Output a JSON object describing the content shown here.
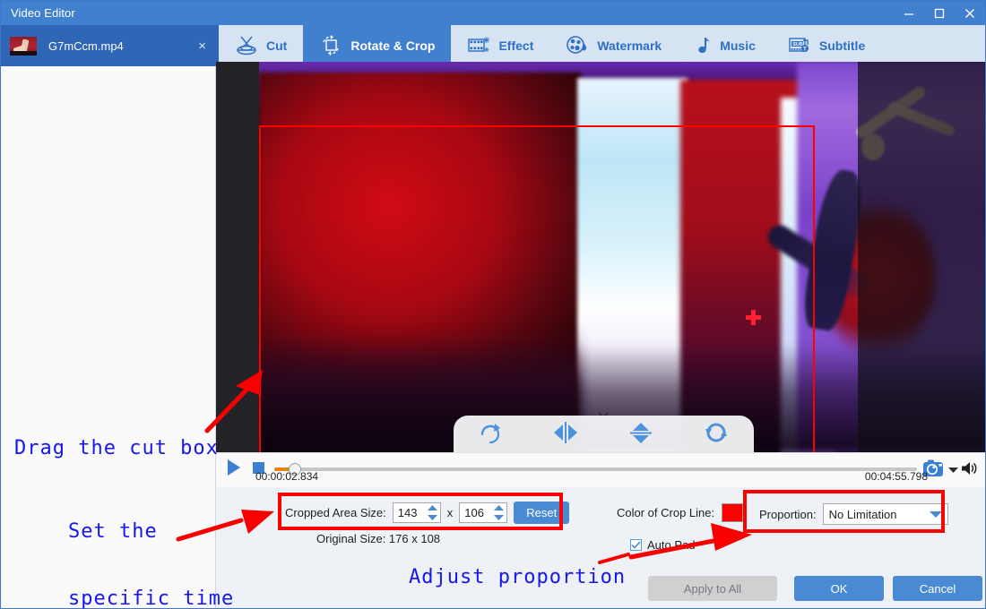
{
  "window": {
    "title": "Video Editor",
    "minimize_icon": "minimize-icon",
    "maximize_icon": "maximize-icon",
    "close_icon": "close-icon"
  },
  "file_tab": {
    "name": "G7mCcm.mp4",
    "close_label": "×"
  },
  "tabs": [
    {
      "label": "Cut",
      "icon": "scissors-icon",
      "active": false
    },
    {
      "label": "Rotate & Crop",
      "icon": "crop-rotate-icon",
      "active": true
    },
    {
      "label": "Effect",
      "icon": "film-sparkle-icon",
      "active": false
    },
    {
      "label": "Watermark",
      "icon": "watermark-drop-icon",
      "active": false
    },
    {
      "label": "Music",
      "icon": "music-note-icon",
      "active": false
    },
    {
      "label": "Subtitle",
      "icon": "subtitle-icon",
      "active": false
    }
  ],
  "stage": {
    "rotate_tools": [
      {
        "name": "rotate-clockwise-icon"
      },
      {
        "name": "flip-horizontal-icon"
      },
      {
        "name": "flip-vertical-icon"
      },
      {
        "name": "rotate-reset-icon"
      }
    ],
    "collapse_icon": "chevron-down-icon",
    "crop_line_color": "#ff0000",
    "crosshair_icon": "crosshair-icon"
  },
  "player": {
    "play_icon": "play-icon",
    "stop_icon": "stop-icon",
    "current_time": "00:00:02.834",
    "total_time": "00:04:55.798",
    "snapshot_icon": "camera-icon",
    "snapshot_dropdown_icon": "chevron-down-icon",
    "volume_icon": "volume-icon",
    "progress_percent": 1
  },
  "options": {
    "cropped_area_label": "Cropped Area Size:",
    "cropped_width": "143",
    "cropped_separator": "x",
    "cropped_height": "106",
    "reset_label": "Reset",
    "original_size_label": "Original Size: 176 x 108",
    "crop_line_label": "Color of Crop Line:",
    "crop_line_color": "#ff0000",
    "proportion_label": "Proportion:",
    "proportion_value": "No Limitation",
    "auto_pad_label": "Auto Pad",
    "auto_pad_checked": true
  },
  "footer": {
    "apply_to_all": "Apply to All",
    "ok": "OK",
    "cancel": "Cancel"
  },
  "annotations": [
    {
      "text": "Drag the cut box"
    },
    {
      "text": "Set the"
    },
    {
      "text": "specific time"
    },
    {
      "text": "Adjust proportion"
    }
  ]
}
